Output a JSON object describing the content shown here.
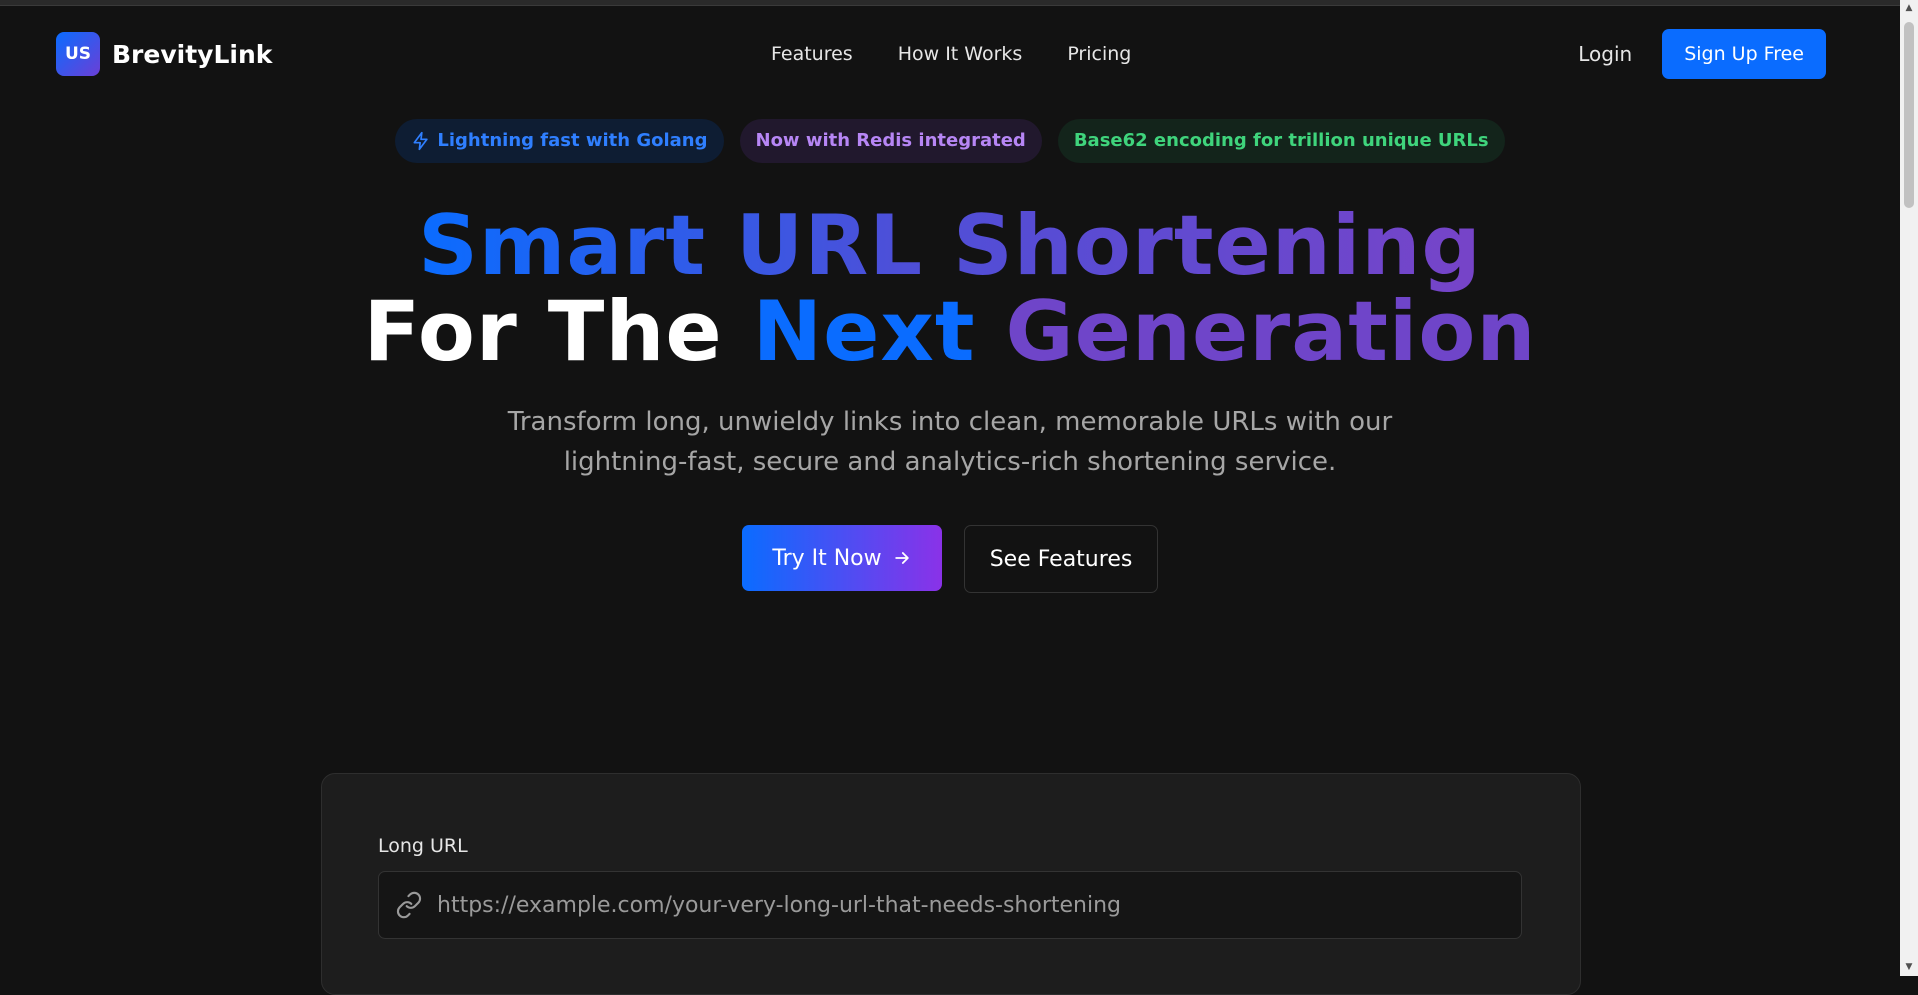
{
  "brand": {
    "badge": "US",
    "name": "BrevityLink",
    "gradient": [
      "#0a6cff",
      "#6b3fd6"
    ]
  },
  "nav": {
    "links": [
      "Features",
      "How It Works",
      "Pricing"
    ],
    "login": "Login",
    "signup": "Sign Up Free"
  },
  "badges": [
    {
      "label": "Lightning fast with Golang",
      "icon": "lightning-icon",
      "color": "#2f7fff"
    },
    {
      "label": "Now with Redis integrated",
      "color": "#b786f5"
    },
    {
      "label": "Base62 encoding for trillion unique URLs",
      "color": "#3fd47c"
    }
  ],
  "hero": {
    "line1": "Smart URL Shortening",
    "line2_a": "For The",
    "line2_b": "Next",
    "line2_c": "Generation",
    "subtitle_1": "Transform long, unwieldy links into clean, memorable URLs with our",
    "subtitle_2": "lightning-fast, secure and analytics-rich shortening service."
  },
  "cta": {
    "primary": "Try It Now",
    "primary_icon": "arrow-right-icon",
    "secondary": "See Features"
  },
  "form": {
    "label": "Long URL",
    "placeholder": "https://example.com/your-very-long-url-that-needs-shortening",
    "icon": "link-icon"
  },
  "colors": {
    "accent": "#0a6cff",
    "background": "#121212",
    "card": "#1d1d1d"
  }
}
